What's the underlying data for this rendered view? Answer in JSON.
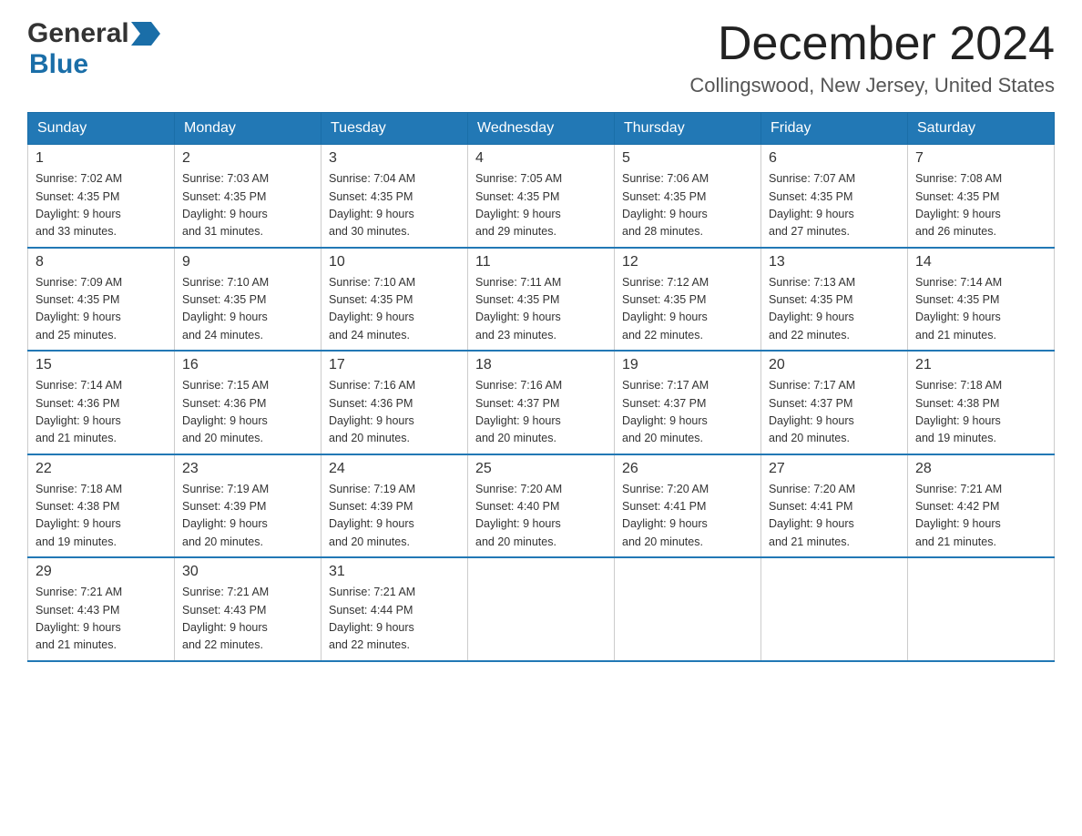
{
  "header": {
    "month_title": "December 2024",
    "location": "Collingswood, New Jersey, United States",
    "logo_general": "General",
    "logo_blue": "Blue"
  },
  "days_of_week": [
    "Sunday",
    "Monday",
    "Tuesday",
    "Wednesday",
    "Thursday",
    "Friday",
    "Saturday"
  ],
  "weeks": [
    [
      {
        "day": "1",
        "sunrise": "7:02 AM",
        "sunset": "4:35 PM",
        "daylight": "9 hours and 33 minutes."
      },
      {
        "day": "2",
        "sunrise": "7:03 AM",
        "sunset": "4:35 PM",
        "daylight": "9 hours and 31 minutes."
      },
      {
        "day": "3",
        "sunrise": "7:04 AM",
        "sunset": "4:35 PM",
        "daylight": "9 hours and 30 minutes."
      },
      {
        "day": "4",
        "sunrise": "7:05 AM",
        "sunset": "4:35 PM",
        "daylight": "9 hours and 29 minutes."
      },
      {
        "day": "5",
        "sunrise": "7:06 AM",
        "sunset": "4:35 PM",
        "daylight": "9 hours and 28 minutes."
      },
      {
        "day": "6",
        "sunrise": "7:07 AM",
        "sunset": "4:35 PM",
        "daylight": "9 hours and 27 minutes."
      },
      {
        "day": "7",
        "sunrise": "7:08 AM",
        "sunset": "4:35 PM",
        "daylight": "9 hours and 26 minutes."
      }
    ],
    [
      {
        "day": "8",
        "sunrise": "7:09 AM",
        "sunset": "4:35 PM",
        "daylight": "9 hours and 25 minutes."
      },
      {
        "day": "9",
        "sunrise": "7:10 AM",
        "sunset": "4:35 PM",
        "daylight": "9 hours and 24 minutes."
      },
      {
        "day": "10",
        "sunrise": "7:10 AM",
        "sunset": "4:35 PM",
        "daylight": "9 hours and 24 minutes."
      },
      {
        "day": "11",
        "sunrise": "7:11 AM",
        "sunset": "4:35 PM",
        "daylight": "9 hours and 23 minutes."
      },
      {
        "day": "12",
        "sunrise": "7:12 AM",
        "sunset": "4:35 PM",
        "daylight": "9 hours and 22 minutes."
      },
      {
        "day": "13",
        "sunrise": "7:13 AM",
        "sunset": "4:35 PM",
        "daylight": "9 hours and 22 minutes."
      },
      {
        "day": "14",
        "sunrise": "7:14 AM",
        "sunset": "4:35 PM",
        "daylight": "9 hours and 21 minutes."
      }
    ],
    [
      {
        "day": "15",
        "sunrise": "7:14 AM",
        "sunset": "4:36 PM",
        "daylight": "9 hours and 21 minutes."
      },
      {
        "day": "16",
        "sunrise": "7:15 AM",
        "sunset": "4:36 PM",
        "daylight": "9 hours and 20 minutes."
      },
      {
        "day": "17",
        "sunrise": "7:16 AM",
        "sunset": "4:36 PM",
        "daylight": "9 hours and 20 minutes."
      },
      {
        "day": "18",
        "sunrise": "7:16 AM",
        "sunset": "4:37 PM",
        "daylight": "9 hours and 20 minutes."
      },
      {
        "day": "19",
        "sunrise": "7:17 AM",
        "sunset": "4:37 PM",
        "daylight": "9 hours and 20 minutes."
      },
      {
        "day": "20",
        "sunrise": "7:17 AM",
        "sunset": "4:37 PM",
        "daylight": "9 hours and 20 minutes."
      },
      {
        "day": "21",
        "sunrise": "7:18 AM",
        "sunset": "4:38 PM",
        "daylight": "9 hours and 19 minutes."
      }
    ],
    [
      {
        "day": "22",
        "sunrise": "7:18 AM",
        "sunset": "4:38 PM",
        "daylight": "9 hours and 19 minutes."
      },
      {
        "day": "23",
        "sunrise": "7:19 AM",
        "sunset": "4:39 PM",
        "daylight": "9 hours and 20 minutes."
      },
      {
        "day": "24",
        "sunrise": "7:19 AM",
        "sunset": "4:39 PM",
        "daylight": "9 hours and 20 minutes."
      },
      {
        "day": "25",
        "sunrise": "7:20 AM",
        "sunset": "4:40 PM",
        "daylight": "9 hours and 20 minutes."
      },
      {
        "day": "26",
        "sunrise": "7:20 AM",
        "sunset": "4:41 PM",
        "daylight": "9 hours and 20 minutes."
      },
      {
        "day": "27",
        "sunrise": "7:20 AM",
        "sunset": "4:41 PM",
        "daylight": "9 hours and 21 minutes."
      },
      {
        "day": "28",
        "sunrise": "7:21 AM",
        "sunset": "4:42 PM",
        "daylight": "9 hours and 21 minutes."
      }
    ],
    [
      {
        "day": "29",
        "sunrise": "7:21 AM",
        "sunset": "4:43 PM",
        "daylight": "9 hours and 21 minutes."
      },
      {
        "day": "30",
        "sunrise": "7:21 AM",
        "sunset": "4:43 PM",
        "daylight": "9 hours and 22 minutes."
      },
      {
        "day": "31",
        "sunrise": "7:21 AM",
        "sunset": "4:44 PM",
        "daylight": "9 hours and 22 minutes."
      },
      null,
      null,
      null,
      null
    ]
  ]
}
